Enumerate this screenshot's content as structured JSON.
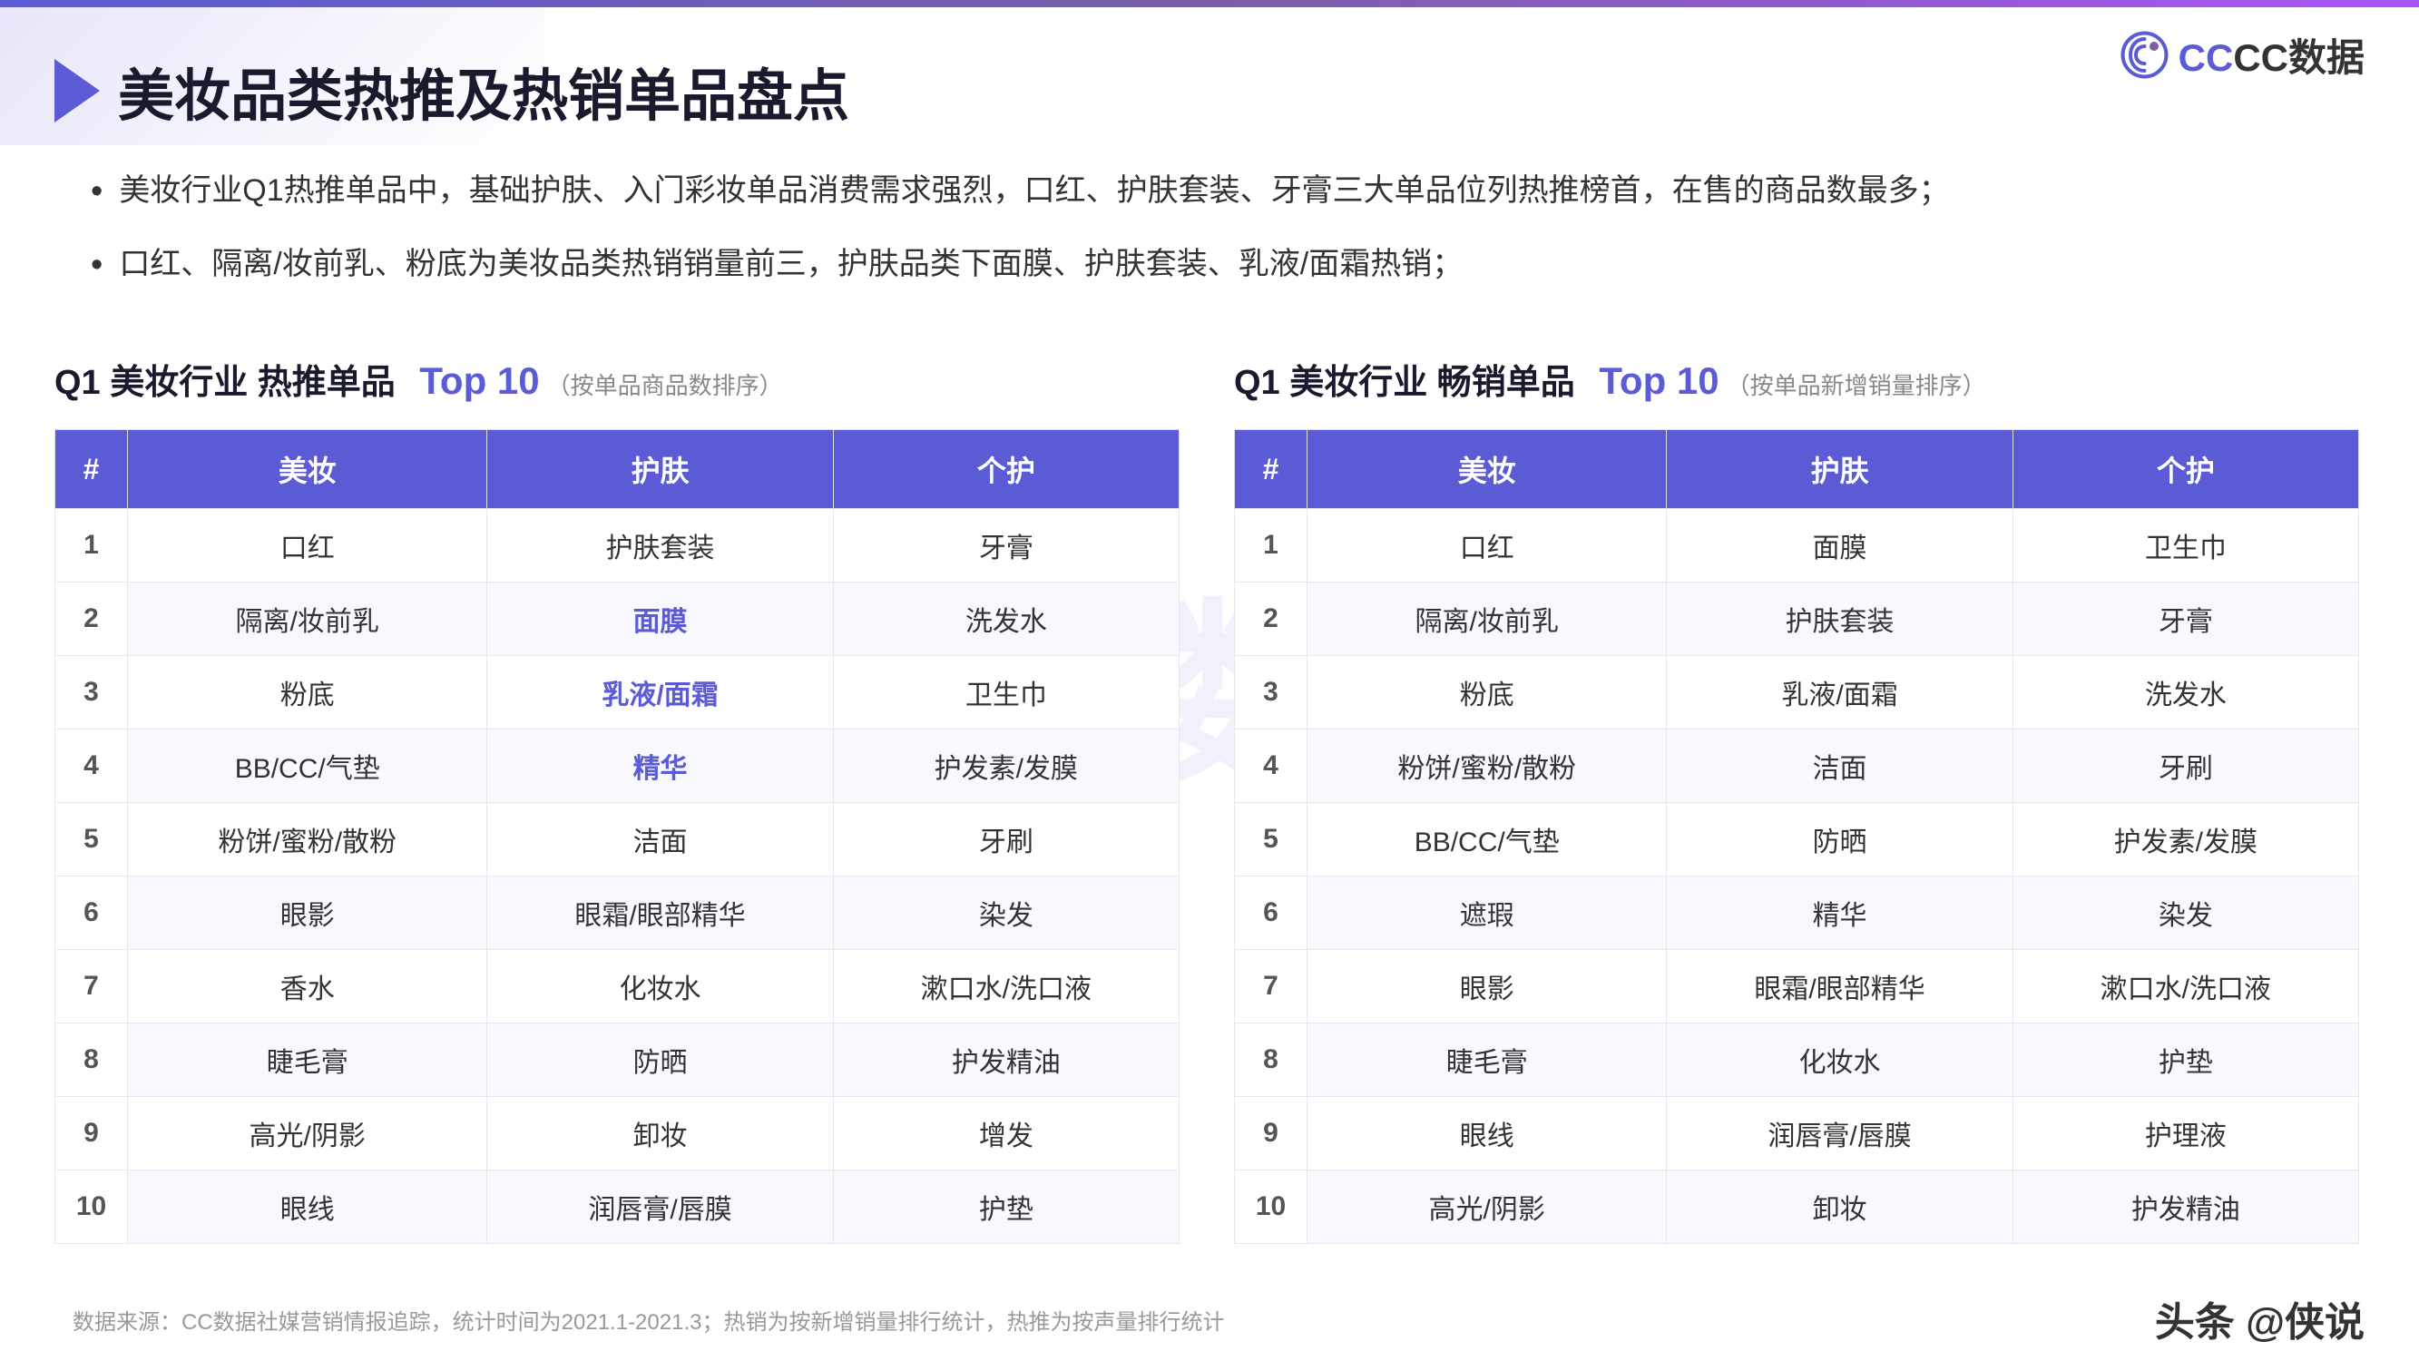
{
  "header": {
    "accent_strip": true,
    "logo_symbol": "CC",
    "logo_label": "CC数据"
  },
  "title": {
    "text": "美妆品类热推及热销单品盘点"
  },
  "bullets": [
    {
      "text": "美妆行业Q1热推单品中，基础护肤、入门彩妆单品消费需求强烈，口红、护肤套装、牙膏三大单品位列热推榜首，在售的商品数最多；"
    },
    {
      "text": "口红、隔离/妆前乳、粉底为美妆品类热销销量前三，护肤品类下面膜、护肤套装、乳液/面霜热销；"
    }
  ],
  "left_table": {
    "title_prefix": "Q1 美妆行业 热推单品",
    "title_top": "Top",
    "title_number": "10",
    "title_suffix": "（按单品商品数排序）",
    "headers": [
      "#",
      "美妆",
      "护肤",
      "个护"
    ],
    "rows": [
      {
        "rank": "1",
        "col1": "口红",
        "col2": "护肤套装",
        "col3": "牙膏",
        "highlight": []
      },
      {
        "rank": "2",
        "col1": "隔离/妆前乳",
        "col2": "面膜",
        "col3": "洗发水",
        "highlight": [
          2
        ]
      },
      {
        "rank": "3",
        "col1": "粉底",
        "col2": "乳液/面霜",
        "col3": "卫生巾",
        "highlight": [
          2
        ]
      },
      {
        "rank": "4",
        "col1": "BB/CC/气垫",
        "col2": "精华",
        "col3": "护发素/发膜",
        "highlight": [
          2
        ]
      },
      {
        "rank": "5",
        "col1": "粉饼/蜜粉/散粉",
        "col2": "洁面",
        "col3": "牙刷",
        "highlight": []
      },
      {
        "rank": "6",
        "col1": "眼影",
        "col2": "眼霜/眼部精华",
        "col3": "染发",
        "highlight": []
      },
      {
        "rank": "7",
        "col1": "香水",
        "col2": "化妆水",
        "col3": "漱口水/洗口液",
        "highlight": []
      },
      {
        "rank": "8",
        "col1": "睫毛膏",
        "col2": "防晒",
        "col3": "护发精油",
        "highlight": []
      },
      {
        "rank": "9",
        "col1": "高光/阴影",
        "col2": "卸妆",
        "col3": "增发",
        "highlight": []
      },
      {
        "rank": "10",
        "col1": "眼线",
        "col2": "润唇膏/唇膜",
        "col3": "护垫",
        "highlight": []
      }
    ]
  },
  "right_table": {
    "title_prefix": "Q1 美妆行业 畅销单品",
    "title_top": "Top",
    "title_number": "10",
    "title_suffix": "（按单品新增销量排序）",
    "headers": [
      "#",
      "美妆",
      "护肤",
      "个护"
    ],
    "rows": [
      {
        "rank": "1",
        "col1": "口红",
        "col2": "面膜",
        "col3": "卫生巾",
        "highlight": []
      },
      {
        "rank": "2",
        "col1": "隔离/妆前乳",
        "col2": "护肤套装",
        "col3": "牙膏",
        "highlight": []
      },
      {
        "rank": "3",
        "col1": "粉底",
        "col2": "乳液/面霜",
        "col3": "洗发水",
        "highlight": []
      },
      {
        "rank": "4",
        "col1": "粉饼/蜜粉/散粉",
        "col2": "洁面",
        "col3": "牙刷",
        "highlight": []
      },
      {
        "rank": "5",
        "col1": "BB/CC/气垫",
        "col2": "防晒",
        "col3": "护发素/发膜",
        "highlight": []
      },
      {
        "rank": "6",
        "col1": "遮瑕",
        "col2": "精华",
        "col3": "染发",
        "highlight": []
      },
      {
        "rank": "7",
        "col1": "眼影",
        "col2": "眼霜/眼部精华",
        "col3": "漱口水/洗口液",
        "highlight": []
      },
      {
        "rank": "8",
        "col1": "睫毛膏",
        "col2": "化妆水",
        "col3": "护垫",
        "highlight": []
      },
      {
        "rank": "9",
        "col1": "眼线",
        "col2": "润唇膏/唇膜",
        "col3": "护理液",
        "highlight": []
      },
      {
        "rank": "10",
        "col1": "高光/阴影",
        "col2": "卸妆",
        "col3": "护发精油",
        "highlight": []
      }
    ]
  },
  "footer": {
    "source": "数据来源：CC数据社媒营销情报追踪，统计时间为2021.1-2021.3；热销为按新增销量排行统计，热推为按声量排行统计",
    "brand": "头条 @侠说"
  },
  "watermark": "CC数据"
}
